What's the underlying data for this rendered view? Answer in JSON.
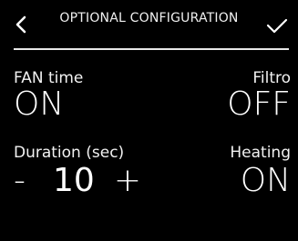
{
  "header": {
    "title": "OPTIONAL CONFIGURATION",
    "back_icon": "chevron-left-icon",
    "confirm_icon": "checkmark-icon"
  },
  "settings": {
    "fan_time": {
      "label": "FAN time",
      "value": "ON"
    },
    "filtro": {
      "label": "Filtro",
      "value": "OFF"
    },
    "duration": {
      "label": "Duration (sec)",
      "minus": "-",
      "value": "10",
      "plus": "+"
    },
    "heating": {
      "label": "Heating",
      "value": "ON"
    }
  },
  "colors": {
    "background": "#000000",
    "foreground": "#ffffff"
  }
}
